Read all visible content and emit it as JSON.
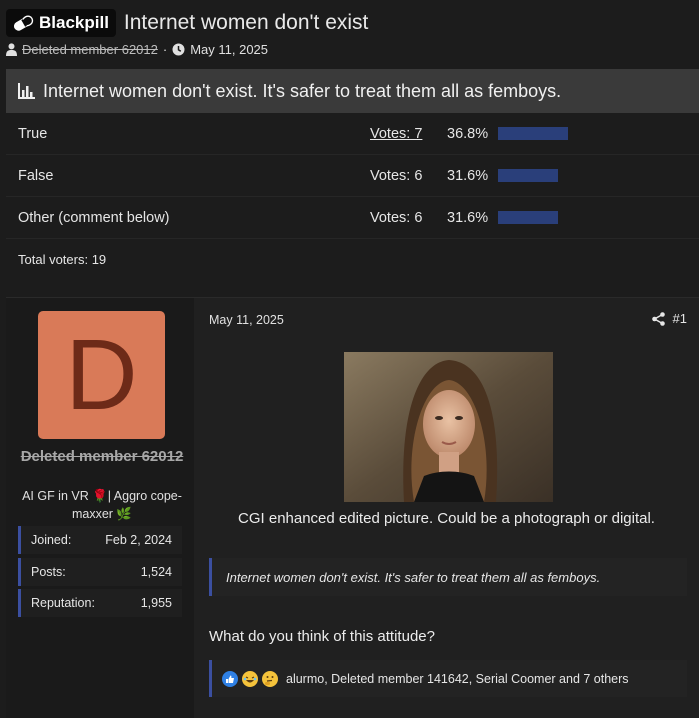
{
  "thread": {
    "prefix": "Blackpill",
    "title": "Internet women don't exist",
    "author": "Deleted member 62012",
    "date": "May 11, 2025",
    "separator": "·"
  },
  "poll": {
    "question": "Internet women don't exist. It's safer to treat them all as femboys.",
    "options": [
      {
        "label": "True",
        "votes": "Votes: 7",
        "percent": "36.8%",
        "fraction": 0.368
      },
      {
        "label": "False",
        "votes": "Votes: 6",
        "percent": "31.6%",
        "fraction": 0.316
      },
      {
        "label": "Other (comment below)",
        "votes": "Votes: 6",
        "percent": "31.6%",
        "fraction": 0.316
      }
    ],
    "total": "Total voters: 19"
  },
  "post": {
    "avatar_letter": "D",
    "username": "Deleted member 62012",
    "user_title": "AI GF in VR 🌹| Aggro cope-maxxer 🌿",
    "stats": [
      {
        "label": "Joined:",
        "value": "Feb 2, 2024"
      },
      {
        "label": "Posts:",
        "value": "1,524"
      },
      {
        "label": "Reputation:",
        "value": "1,955"
      }
    ],
    "date": "May 11, 2025",
    "post_number": "#1",
    "caption": "CGI enhanced edited picture. Could be a photograph or digital.",
    "quote": "Internet women don't exist. It's safer to treat them all as femboys.",
    "question": "What do you think of this attitude?",
    "reactions_text": "alurmo, Deleted member 141642, Serial Coomer and 7 others"
  },
  "colors": {
    "background": "#1c1c1c",
    "poll_bar": "#2a3f7a",
    "accent_border": "#3b4fa0",
    "avatar_bg": "#d97a58",
    "avatar_letter": "#6d2a18"
  }
}
